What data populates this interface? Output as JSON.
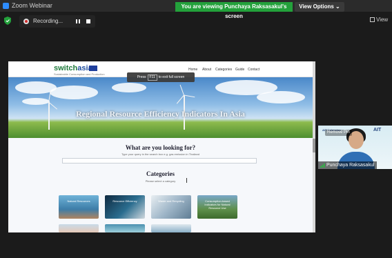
{
  "window": {
    "title": "Zoom Webinar"
  },
  "banner": {
    "text": "You are viewing Punchaya Raksasakul's screen"
  },
  "view_options": {
    "label": "View Options ⌄"
  },
  "recording": {
    "label": "Recording..."
  },
  "view_button": {
    "label": "View"
  },
  "shared": {
    "logo_primary": "switch",
    "logo_secondary": "asia",
    "logo_tagline": "Sustainable Consumption and Production",
    "nav": [
      "Home",
      "About",
      "Categories",
      "Guide",
      "Contact"
    ],
    "fullscreen_hint": {
      "pre": "Press",
      "key": "F11",
      "post": "to exit full screen"
    },
    "hero_title": "Regional Resource Efficiency Indicators In Asia",
    "question": "What are you looking for?",
    "question_sub": "Type your query in the search box e.g. gas emission in Thailand",
    "categories_title": "Categories",
    "categories_sub": "Please select a category",
    "cards": [
      "Natural Resources",
      "Resource Efficiency",
      "Waste and Recycling",
      "Consumption-based Indicators for Natural Resource Use"
    ]
  },
  "participant": {
    "name": "Punchaya Raksasakul",
    "remove_label": "Remove Pin",
    "org": "AIT",
    "org_small": "AIT Extension"
  },
  "colors": {
    "banner": "#23a13b",
    "accent": "#2d8cff"
  }
}
